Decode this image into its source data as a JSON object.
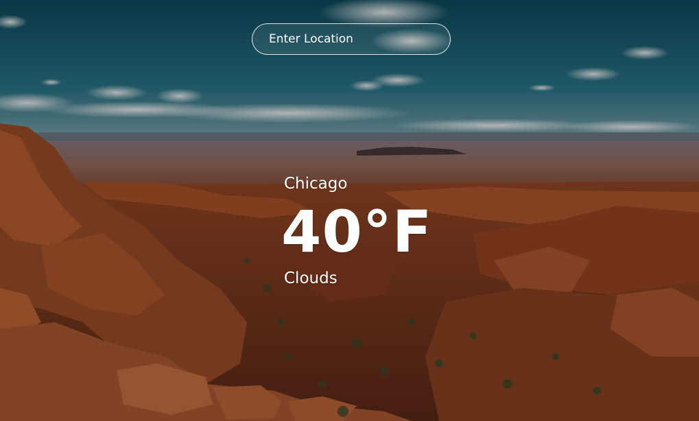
{
  "search": {
    "placeholder": "Enter Location",
    "value": ""
  },
  "weather": {
    "city": "Chicago",
    "temperature": "40°F",
    "description": "Clouds"
  },
  "background": {
    "sky_color": "#1f5f73",
    "rock_color": "#a24a23"
  }
}
